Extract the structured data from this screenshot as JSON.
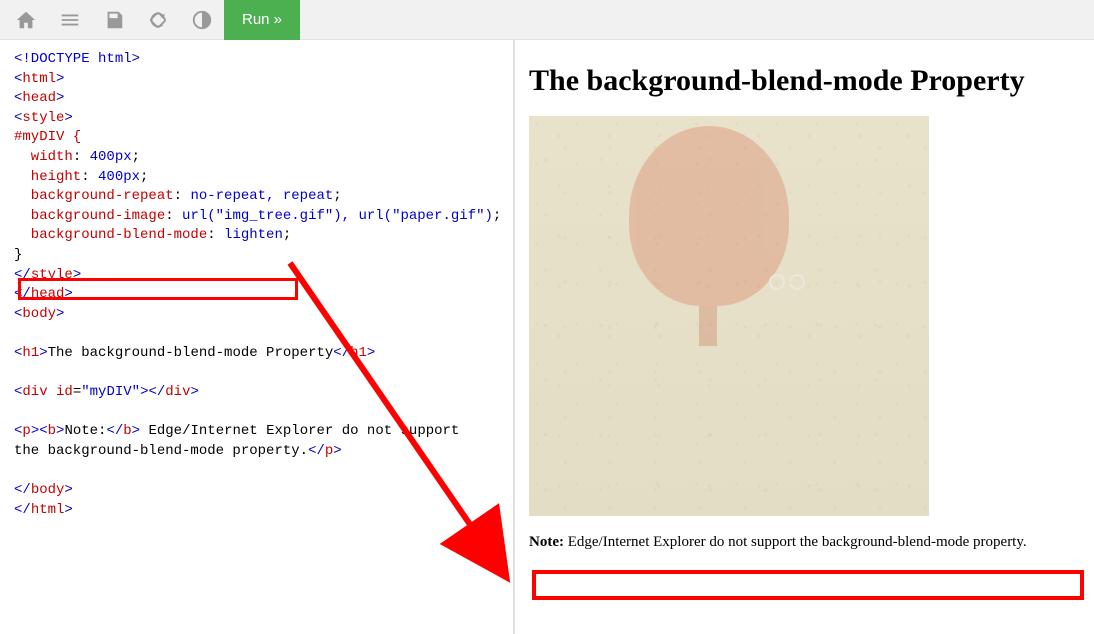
{
  "toolbar": {
    "run_label": "Run »"
  },
  "code": {
    "l1": "<!DOCTYPE html>",
    "l2o": "<",
    "l2t": "html",
    "l2c": ">",
    "l3o": "<",
    "l3t": "head",
    "l3c": ">",
    "l4o": "<",
    "l4t": "style",
    "l4c": ">",
    "l5": "#myDIV {",
    "l6a": "  width",
    "l6b": ": ",
    "l6c": "400px",
    "l6d": ";",
    "l7a": "  height",
    "l7b": ": ",
    "l7c": "400px",
    "l7d": ";",
    "l8a": "  background-repeat",
    "l8b": ": ",
    "l8c": "no-repeat, repeat",
    "l8d": ";",
    "l9a": "  background-image",
    "l9b": ": ",
    "l9c": "url(\"img_tree.gif\"), url(\"paper.gif\")",
    "l9d": ";",
    "l10a": "  background-blend-mode",
    "l10b": ": ",
    "l10c": "lighten",
    "l10d": ";",
    "l11": "}",
    "l12o": "</",
    "l12t": "style",
    "l12c": ">",
    "l13o": "</",
    "l13t": "head",
    "l13c": ">",
    "l14o": "<",
    "l14t": "body",
    "l14c": ">",
    "blank1": " ",
    "l15o": "<",
    "l15t": "h1",
    "l15c": ">",
    "l15x": "The background-blend-mode Property",
    "l15e1": "</",
    "l15e2": "h1",
    "l15e3": ">",
    "blank2": " ",
    "l16o": "<",
    "l16t": "div",
    "l16sp": " ",
    "l16a": "id",
    "l16eq": "=",
    "l16v": "\"myDIV\"",
    "l16c": ">",
    "l16e1": "</",
    "l16e2": "div",
    "l16e3": ">",
    "blank3": " ",
    "l17o": "<",
    "l17t": "p",
    "l17c": ">",
    "l17bo": "<",
    "l17bt": "b",
    "l17bc": ">",
    "l17bx": "Note:",
    "l17be1": "</",
    "l17be2": "b",
    "l17be3": ">",
    "l17x": " Edge/Internet Explorer do not support",
    "l18x": "the background-blend-mode property.",
    "l18e1": "</",
    "l18e2": "p",
    "l18e3": ">",
    "blank4": " ",
    "l19o": "</",
    "l19t": "body",
    "l19c": ">",
    "l20o": "</",
    "l20t": "html",
    "l20c": ">"
  },
  "preview": {
    "heading": "The background-blend-mode Property",
    "note_label": "Note:",
    "note_text": " Edge/Internet Explorer do not support the background-blend-mode property."
  }
}
